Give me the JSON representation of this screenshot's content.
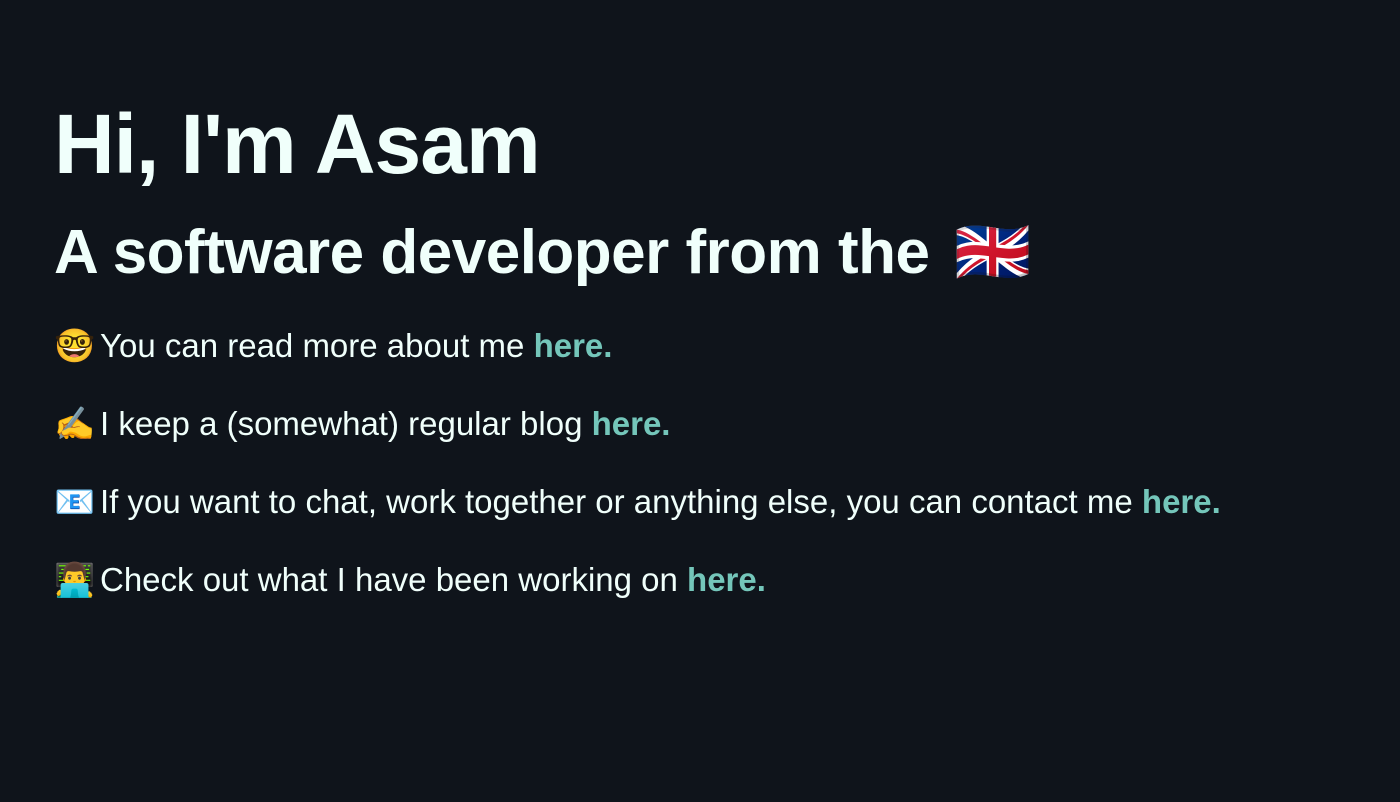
{
  "hero": {
    "title": "Hi, I'm Asam",
    "subtitle": "A software developer from the",
    "subtitle_flag": "🇬🇧"
  },
  "lines": [
    {
      "emoji": "🤓",
      "text": "You can read more about me ",
      "link_label": "here."
    },
    {
      "emoji": "✍️",
      "text": "I keep a (somewhat) regular blog ",
      "link_label": "here."
    },
    {
      "emoji": "📧",
      "text": "If you want to chat, work together or anything else, you can contact me ",
      "link_label": "here."
    },
    {
      "emoji": "👨‍💻",
      "text": "Check out what I have been working on ",
      "link_label": "here."
    }
  ],
  "colors": {
    "background": "#0f141b",
    "text": "#f0fffb",
    "link": "#74c6ba"
  }
}
